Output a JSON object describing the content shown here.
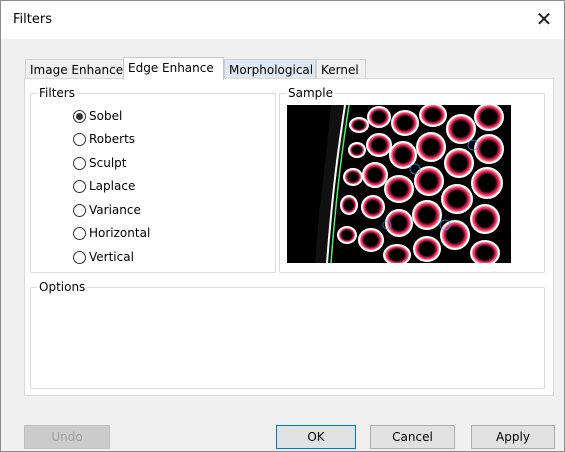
{
  "window": {
    "title": "Filters"
  },
  "tabs": [
    {
      "label": "Image Enhance"
    },
    {
      "label": "Edge Enhance"
    },
    {
      "label": "Morphological"
    },
    {
      "label": "Kernel"
    }
  ],
  "filters_group": {
    "label": "Filters",
    "selected": "Sobel",
    "options": [
      {
        "label": "Sobel"
      },
      {
        "label": "Roberts"
      },
      {
        "label": "Sculpt"
      },
      {
        "label": "Laplace"
      },
      {
        "label": "Variance"
      },
      {
        "label": "Horizontal"
      },
      {
        "label": "Vertical"
      }
    ]
  },
  "sample_group": {
    "label": "Sample"
  },
  "options_group": {
    "label": "Options"
  },
  "buttons": {
    "undo": "Undo",
    "ok": "OK",
    "cancel": "Cancel",
    "apply": "Apply"
  },
  "colors": {
    "accent": "#0078d7",
    "tab_hover": "#dde8f3"
  },
  "icons": {
    "close": "close-icon",
    "radio": "radio-icon"
  }
}
